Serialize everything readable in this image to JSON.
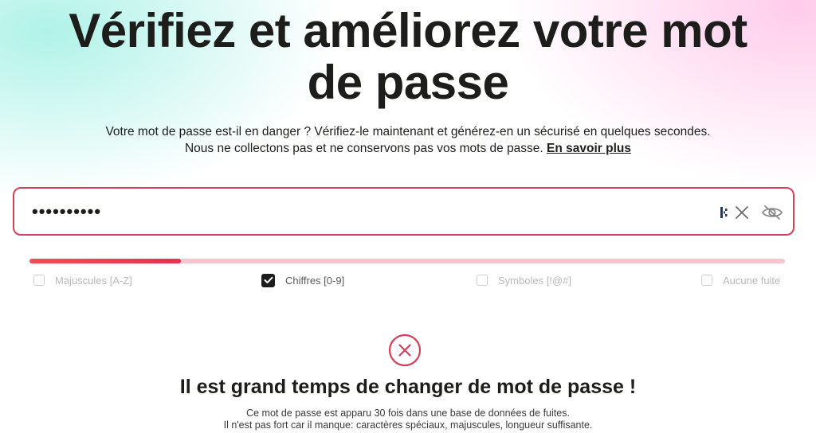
{
  "hero": {
    "title_line1": "Vérifiez et améliorez votre mot",
    "title_line2": "de passe",
    "subtitle_line1": "Votre mot de passe est-il en danger ? Vérifiez-le maintenant et générez-en un sécurisé en quelques secondes.",
    "subtitle_line2": "Nous ne collectons pas et ne conservons pas vos mots de passe.",
    "learn_more_link": "En savoir plus"
  },
  "password_input": {
    "masked_value": "••••••••••",
    "icons": [
      "password-manager-icon",
      "clear-icon",
      "eye-slash-icon"
    ]
  },
  "strength_meter": {
    "level": 0.2,
    "fill_color": "#e3334f",
    "track_color": "#f7c5cf"
  },
  "criteria": [
    {
      "label": "Majuscules [A-Z]",
      "checked": false
    },
    {
      "label": "Chiffres [0-9]",
      "checked": true
    },
    {
      "label": "Symboles [!@#]",
      "checked": false
    },
    {
      "label": "Aucune fuite",
      "checked": false
    }
  ],
  "result": {
    "icon": "fail-x-icon",
    "title": "Il est grand temps de changer de mot de passe !",
    "detail_line1": "Ce mot de passe est apparu 30 fois dans une base de données de fuites.",
    "detail_line2": "Il n'est pas fort car il manque: caractères spéciaux, majuscules, longueur suffisante.",
    "status_color": "#d6405b"
  }
}
